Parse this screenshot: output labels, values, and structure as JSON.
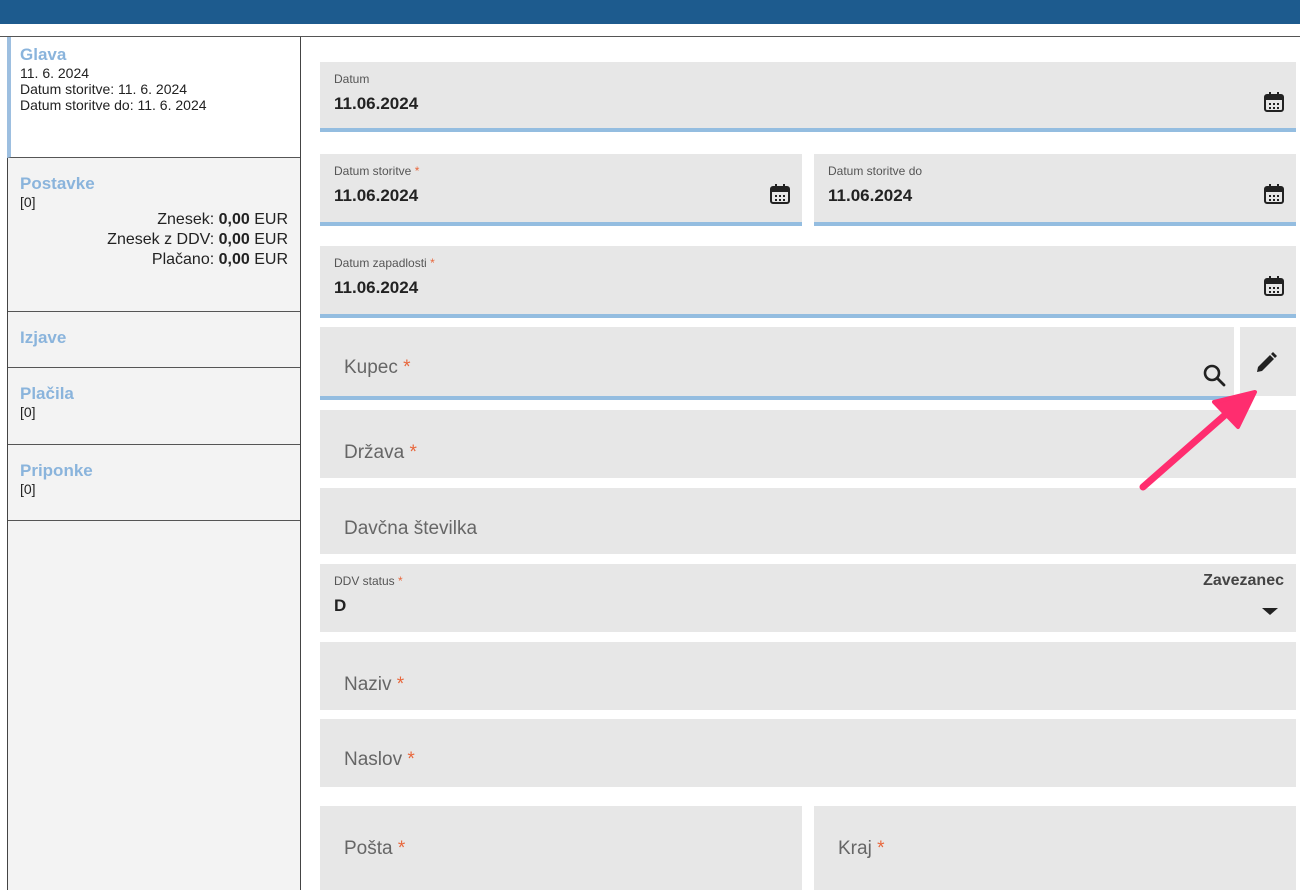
{
  "sidebar": {
    "glava": {
      "title": "Glava",
      "date": "11. 6. 2024",
      "service_date": "Datum storitve: 11. 6. 2024",
      "service_date_to": "Datum storitve do: 11. 6. 2024"
    },
    "postavke": {
      "title": "Postavke",
      "count": "[0]",
      "znesek_label": "Znesek:",
      "znesek_value": "0,00",
      "znesek_ddv_label": "Znesek z DDV:",
      "znesek_ddv_value": "0,00",
      "placano_label": "Plačano:",
      "placano_value": "0,00",
      "currency": "EUR"
    },
    "izjave": {
      "title": "Izjave"
    },
    "placila": {
      "title": "Plačila",
      "count": "[0]"
    },
    "priponke": {
      "title": "Priponke",
      "count": "[0]"
    }
  },
  "form": {
    "datum": {
      "label": "Datum",
      "value": "11.06.2024"
    },
    "datum_storitve": {
      "label": "Datum storitve",
      "value": "11.06.2024"
    },
    "datum_storitve_do": {
      "label": "Datum storitve do",
      "value": "11.06.2024"
    },
    "datum_zapadlosti": {
      "label": "Datum zapadlosti",
      "value": "11.06.2024"
    },
    "kupec": {
      "placeholder": "Kupec"
    },
    "drzava": {
      "placeholder": "Država"
    },
    "davcna": {
      "placeholder": "Davčna številka"
    },
    "ddv_status": {
      "label": "DDV status",
      "value": "D",
      "selected": "Zavezanec"
    },
    "naziv": {
      "placeholder": "Naziv"
    },
    "naslov": {
      "placeholder": "Naslov"
    },
    "posta": {
      "placeholder": "Pošta"
    },
    "kraj": {
      "placeholder": "Kraj"
    },
    "required_mark": "*"
  },
  "icons": {
    "calendar": "calendar-icon",
    "search": "search-icon",
    "edit": "pencil-icon",
    "dropdown": "caret-down-icon"
  },
  "colors": {
    "topbar": "#1d5b8e",
    "accent": "#94bde0",
    "sidebar_title": "#8ab4dc",
    "required": "#e8673c",
    "field_bg": "#e7e7e7",
    "arrow": "#ff2d6f"
  }
}
